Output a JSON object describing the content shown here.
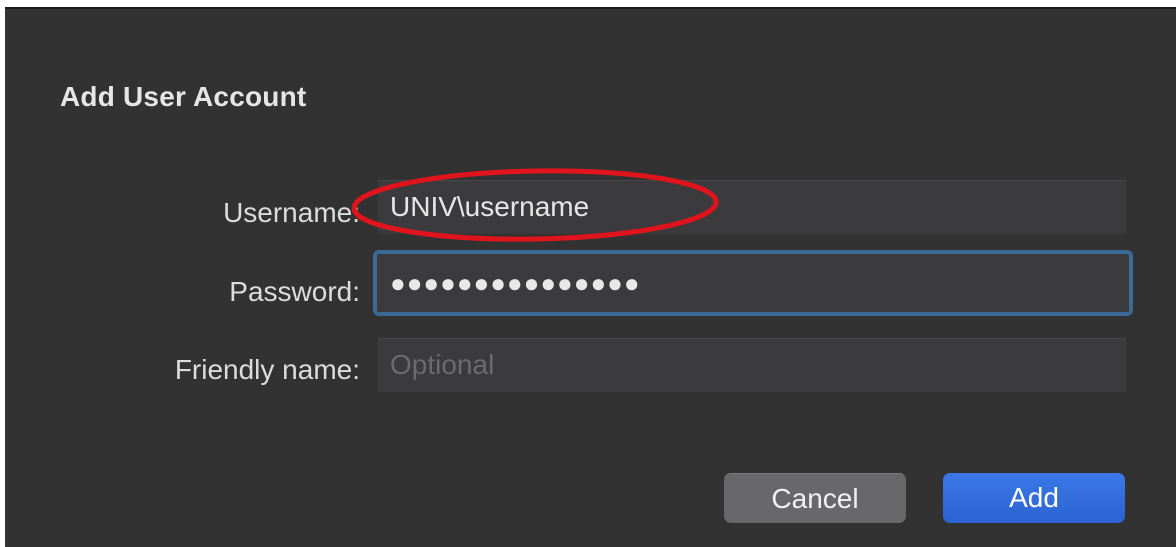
{
  "dialog": {
    "title": "Add User Account"
  },
  "form": {
    "username": {
      "label": "Username:",
      "value": "UNIV\\username"
    },
    "password": {
      "label": "Password:",
      "value": "●●●●●●●●●●●●●●●"
    },
    "friendly_name": {
      "label": "Friendly name:",
      "placeholder": "Optional",
      "value": ""
    }
  },
  "buttons": {
    "cancel_label": "Cancel",
    "add_label": "Add"
  },
  "annotation": {
    "color": "#e0141c",
    "shape": "ellipse"
  },
  "colors": {
    "dialog_background": "#323233",
    "focus_ring": "#3d6a95",
    "primary_button": "#2f6ad9",
    "secondary_button": "#68676a"
  }
}
